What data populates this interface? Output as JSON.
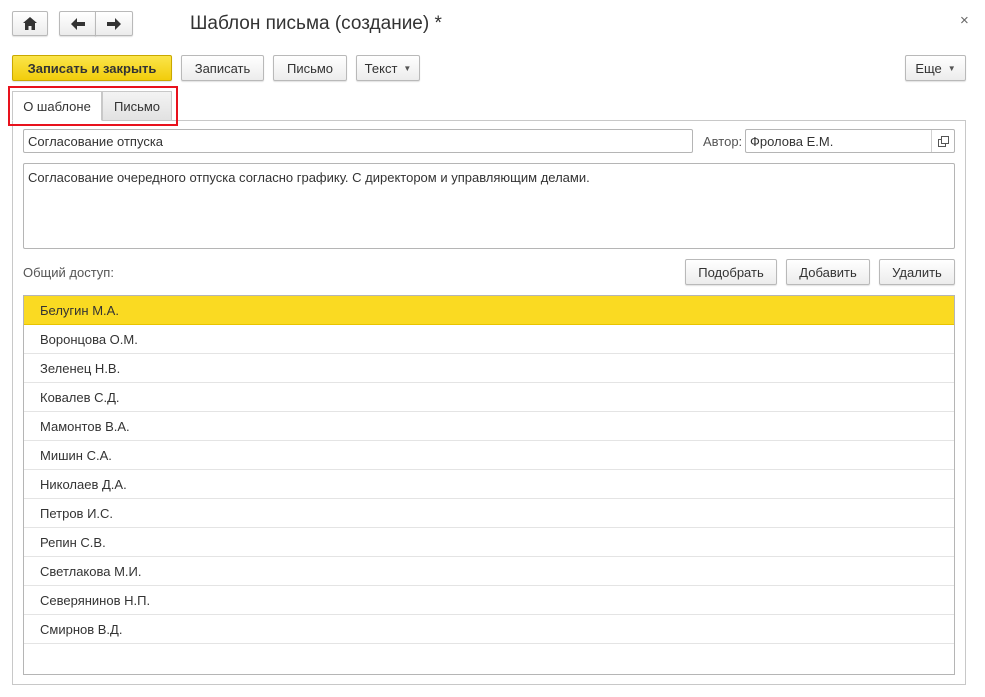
{
  "window": {
    "title": "Шаблон письма (создание) *",
    "close_glyph": "×"
  },
  "toolbar": {
    "save_close_label": "Записать и закрыть",
    "save_label": "Записать",
    "letter_label": "Письмо",
    "text_label": "Текст",
    "more_label": "Еще"
  },
  "tabs": [
    {
      "label": "О шаблоне",
      "active": true
    },
    {
      "label": "Письмо",
      "active": false
    }
  ],
  "form": {
    "subject_value": "Согласование отпуска",
    "author_label": "Автор:",
    "author_value": "Фролова Е.М.",
    "description_value": "Согласование очередного отпуска согласно графику. С директором и управляющим делами.",
    "shared_access_label": "Общий доступ:",
    "pick_label": "Подобрать",
    "add_label": "Добавить",
    "delete_label": "Удалить"
  },
  "users": [
    "Белугин М.А.",
    "Воронцова О.М.",
    "Зеленец Н.В.",
    "Ковалев С.Д.",
    "Мамонтов В.А.",
    "Мишин С.А.",
    "Николаев Д.А.",
    "Петров И.С.",
    "Репин С.В.",
    "Светлакова М.И.",
    "Северянинов Н.П.",
    "Смирнов В.Д."
  ],
  "selected_user_index": 0,
  "colors": {
    "accent": "#f2cd0b",
    "selection": "#fada22",
    "highlight_frame": "#e8121d"
  }
}
